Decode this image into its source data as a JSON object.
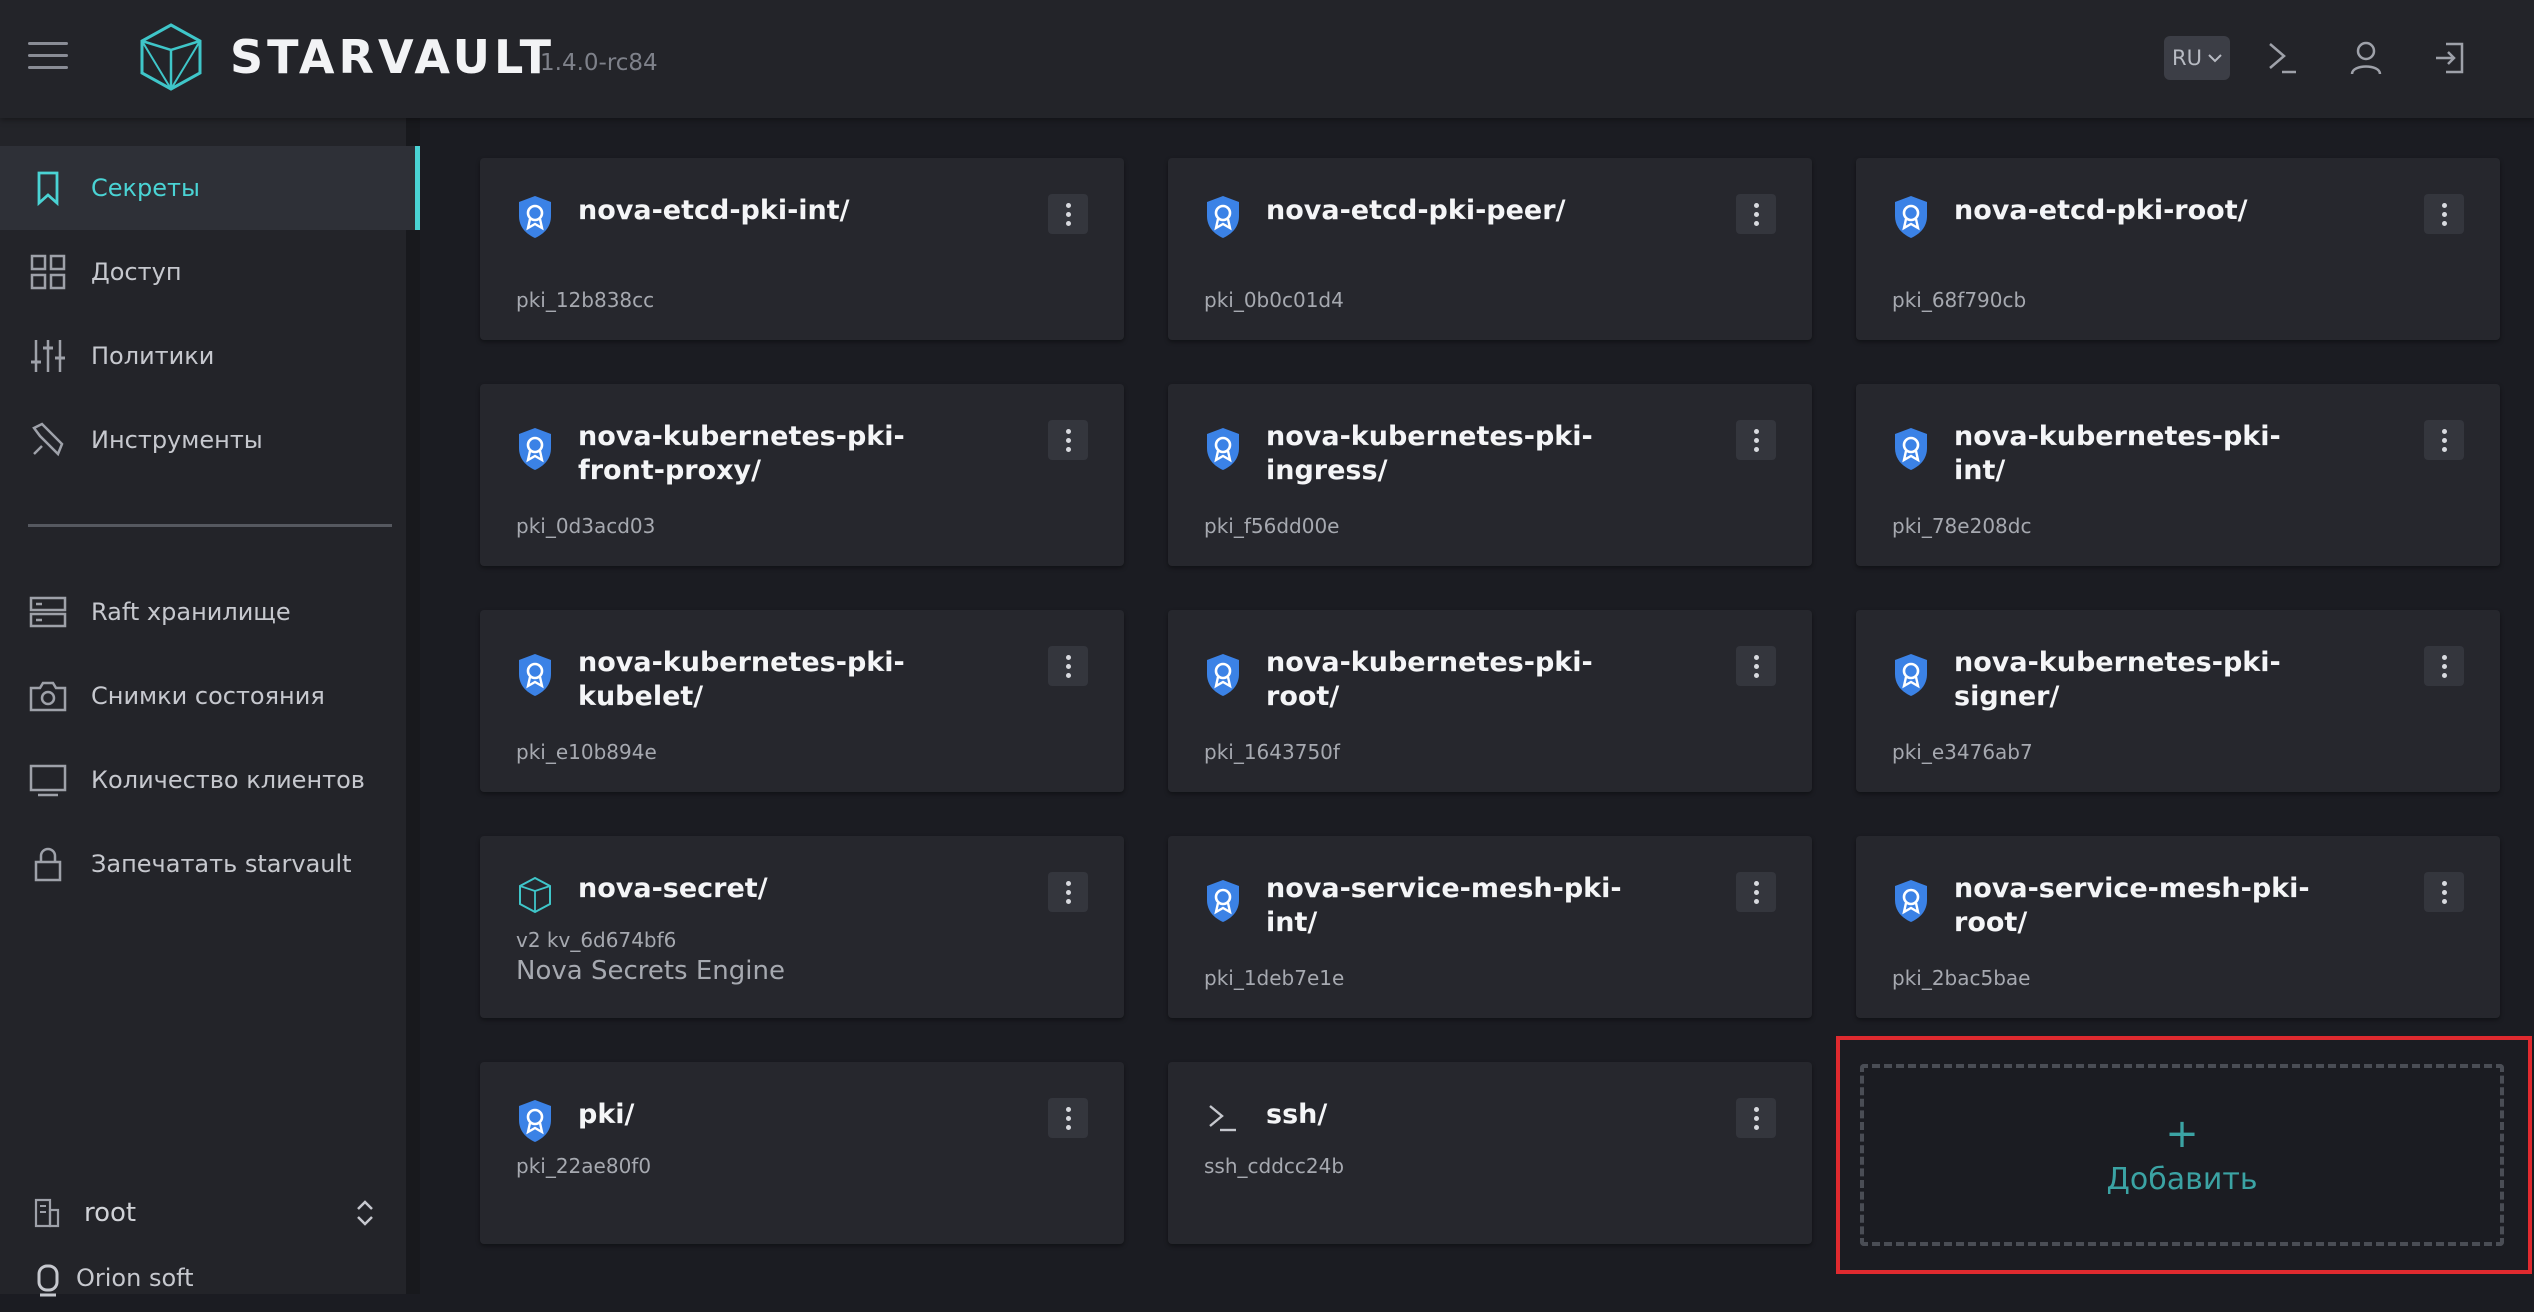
{
  "header": {
    "brand": "STARVAULT",
    "version": "1.4.0-rc84",
    "lang": "RU"
  },
  "sidebar": {
    "items": [
      {
        "label": "Секреты",
        "icon": "bookmark-icon",
        "active": true
      },
      {
        "label": "Доступ",
        "icon": "grid-icon"
      },
      {
        "label": "Политики",
        "icon": "sliders-icon"
      },
      {
        "label": "Инструменты",
        "icon": "wrench-icon"
      }
    ],
    "items2": [
      {
        "label": "Raft хранилище",
        "icon": "server-icon"
      },
      {
        "label": "Снимки состояния",
        "icon": "camera-icon"
      },
      {
        "label": "Количество клиентов",
        "icon": "monitor-icon"
      },
      {
        "label": "Запечатать starvault",
        "icon": "lock-icon"
      }
    ],
    "namespace": "root",
    "brand_footer": "Orion soft"
  },
  "engines": [
    {
      "title": "nova-etcd-pki-int/",
      "accessor": "pki_12b838cc",
      "icon": "certificate-icon"
    },
    {
      "title": "nova-etcd-pki-peer/",
      "accessor": "pki_0b0c01d4",
      "icon": "certificate-icon"
    },
    {
      "title": "nova-etcd-pki-root/",
      "accessor": "pki_68f790cb",
      "icon": "certificate-icon"
    },
    {
      "title": "nova-kubernetes-pki-front-proxy/",
      "accessor": "pki_0d3acd03",
      "icon": "certificate-icon"
    },
    {
      "title": "nova-kubernetes-pki-ingress/",
      "accessor": "pki_f56dd00e",
      "icon": "certificate-icon"
    },
    {
      "title": "nova-kubernetes-pki-int/",
      "accessor": "pki_78e208dc",
      "icon": "certificate-icon"
    },
    {
      "title": "nova-kubernetes-pki-kubelet/",
      "accessor": "pki_e10b894e",
      "icon": "certificate-icon"
    },
    {
      "title": "nova-kubernetes-pki-root/",
      "accessor": "pki_1643750f",
      "icon": "certificate-icon"
    },
    {
      "title": "nova-kubernetes-pki-signer/",
      "accessor": "pki_e3476ab7",
      "icon": "certificate-icon"
    },
    {
      "title": "nova-secret/",
      "accessor": "v2 kv_6d674bf6",
      "description": "Nova Secrets Engine",
      "icon": "kv-icon"
    },
    {
      "title": "nova-service-mesh-pki-int/",
      "accessor": "pki_1deb7e1e",
      "icon": "certificate-icon"
    },
    {
      "title": "nova-service-mesh-pki-root/",
      "accessor": "pki_2bac5bae",
      "icon": "certificate-icon"
    },
    {
      "title": "pki/",
      "accessor": "pki_22ae80f0",
      "icon": "certificate-icon"
    },
    {
      "title": "ssh/",
      "accessor": "ssh_cddcc24b",
      "icon": "terminal-icon"
    }
  ],
  "add_card": {
    "plus": "+",
    "label": "Добавить"
  },
  "colors": {
    "accent": "#4ad3d4",
    "cert": "#3b82e6",
    "highlight": "#e02a2f"
  }
}
